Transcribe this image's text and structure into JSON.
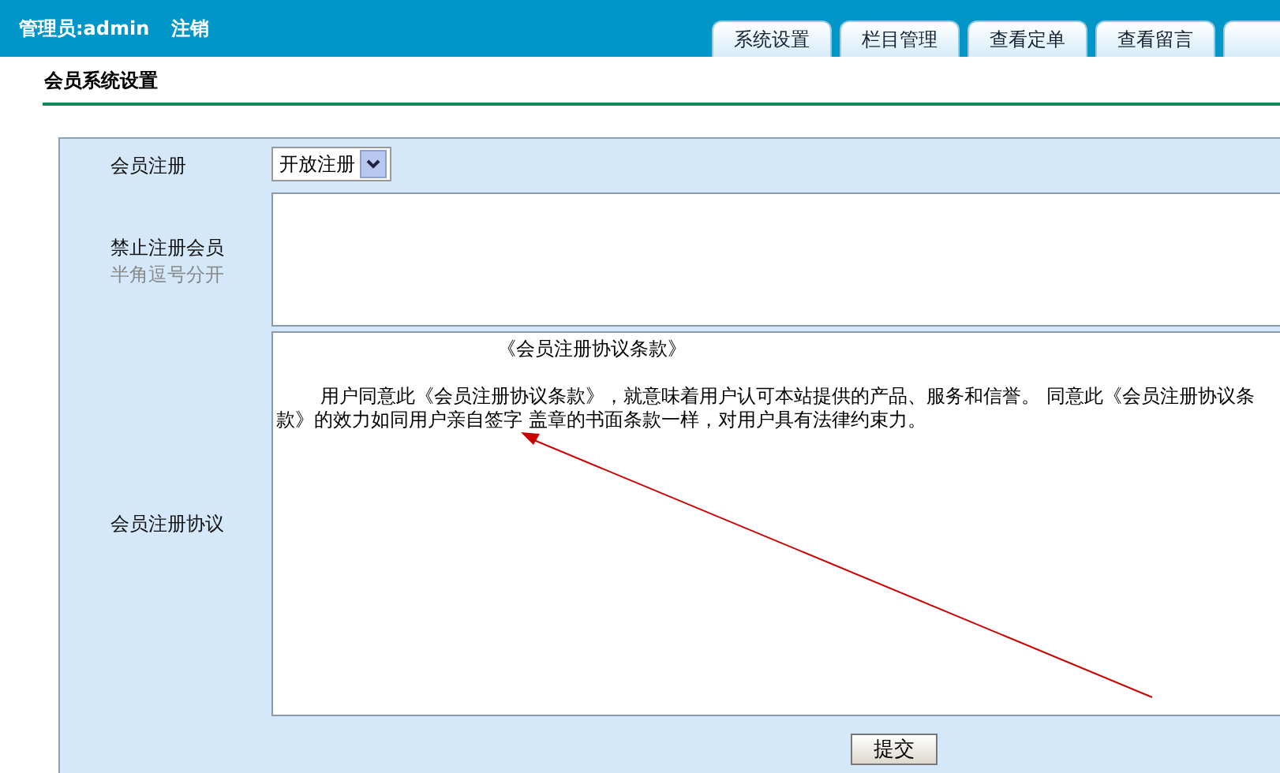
{
  "header": {
    "admin_label": "管理员:admin",
    "logout": "注销"
  },
  "tabs": [
    {
      "label": "系统设置",
      "selected": false
    },
    {
      "label": "栏目管理",
      "selected": false
    },
    {
      "label": "查看定单",
      "selected": false
    },
    {
      "label": "查看留言",
      "selected": false
    }
  ],
  "section_title": "会员系统设置",
  "form": {
    "registration": {
      "label": "会员注册",
      "value": "开放注册"
    },
    "banned_members": {
      "label": "禁止注册会员",
      "hint": "半角逗号分开"
    },
    "agreement": {
      "label": "会员注册协议",
      "title": "《会员注册协议条款》",
      "body": "用户同意此《会员注册协议条款》，就意味着用户认可本站提供的产品、服务和信誉。 同意此《会员注册协议条款》的效力如同用户亲自签字 盖章的书面条款一样，对用户具有法律约束力。"
    },
    "submit": "提交"
  }
}
